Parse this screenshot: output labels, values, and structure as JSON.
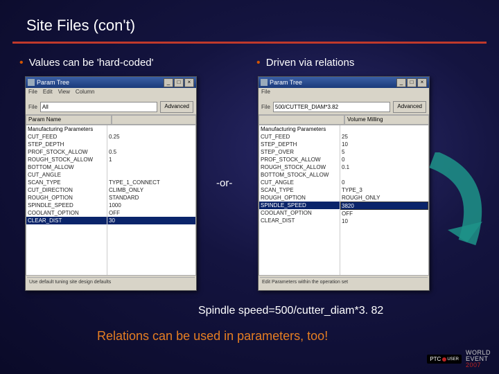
{
  "slide": {
    "title": "Site Files (con't)",
    "bullet_left": "Values can be 'hard-coded'",
    "bullet_right": "Driven via relations",
    "or_text": "-or-",
    "formula": "Spindle speed=500/cutter_diam*3. 82",
    "footer": "Relations can be used in parameters, too!"
  },
  "win_left": {
    "title": "Param Tree",
    "menu": [
      "File",
      "Edit",
      "View",
      "Column"
    ],
    "toolbar_label": "File",
    "toolbar_input": "All",
    "toolbar_btn": "Advanced",
    "col1_header": "Param Name",
    "col2_header": "",
    "rows": [
      {
        "name": "Manufacturing Parameters",
        "val": ""
      },
      {
        "name": "  CUT_FEED",
        "val": "0.25"
      },
      {
        "name": "  STEP_DEPTH",
        "val": ""
      },
      {
        "name": "  PROF_STOCK_ALLOW",
        "val": "0.5"
      },
      {
        "name": "  ROUGH_STOCK_ALLOW",
        "val": "1"
      },
      {
        "name": "  BOTTOM_ALLOW",
        "val": ""
      },
      {
        "name": "  CUT_ANGLE",
        "val": ""
      },
      {
        "name": "  SCAN_TYPE",
        "val": "TYPE_1_CONNECT"
      },
      {
        "name": "  CUT_DIRECTION",
        "val": "CLIMB_ONLY"
      },
      {
        "name": "  ROUGH_OPTION",
        "val": "STANDARD"
      },
      {
        "name": "  SPINDLE_SPEED",
        "val": "1000"
      },
      {
        "name": "  COOLANT_OPTION",
        "val": "OFF"
      },
      {
        "name": "  CLEAR_DIST",
        "val": "30"
      }
    ],
    "highlight_index": 12,
    "status": "Use default tuning site design defaults"
  },
  "win_right": {
    "title": "Param Tree",
    "menu": [
      "File"
    ],
    "toolbar_label": "File",
    "toolbar_input": "500/CUTTER_DIAM*3.82",
    "toolbar_btn": "Advanced",
    "col1_header": "",
    "col2_header": "Volume Milling",
    "rows": [
      {
        "name": "Manufacturing Parameters",
        "val": ""
      },
      {
        "name": "  CUT_FEED",
        "val": "25"
      },
      {
        "name": "  STEP_DEPTH",
        "val": "10"
      },
      {
        "name": "  STEP_OVER",
        "val": "5"
      },
      {
        "name": "  PROF_STOCK_ALLOW",
        "val": "0"
      },
      {
        "name": "  ROUGH_STOCK_ALLOW",
        "val": "0.1"
      },
      {
        "name": "  BOTTOM_STOCK_ALLOW",
        "val": ""
      },
      {
        "name": "  CUT_ANGLE",
        "val": "0"
      },
      {
        "name": "  SCAN_TYPE",
        "val": "TYPE_3"
      },
      {
        "name": "  ROUGH_OPTION",
        "val": "ROUGH_ONLY"
      },
      {
        "name": "  SPINDLE_SPEED",
        "val": "3820"
      },
      {
        "name": "  COOLANT_OPTION",
        "val": "OFF"
      },
      {
        "name": "  CLEAR_DIST",
        "val": "10"
      }
    ],
    "highlight_index": 10,
    "boxed_index": 10,
    "status": "Edit Parameters within the operation set"
  },
  "logo": {
    "ptc": "PTC",
    "user": "USER",
    "event1": "WORLD",
    "event2": "EVENT",
    "year": "2007"
  }
}
